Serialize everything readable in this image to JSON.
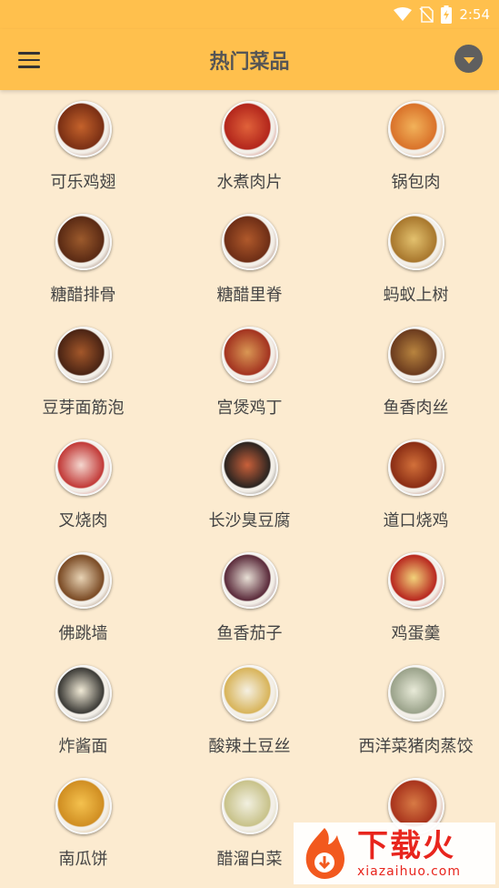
{
  "status": {
    "time": "2:54"
  },
  "appbar": {
    "title": "热门菜品"
  },
  "dishes": [
    {
      "label": "可乐鸡翅",
      "c1": "#7a2f14",
      "c2": "#c4622b"
    },
    {
      "label": "水煮肉片",
      "c1": "#b3261c",
      "c2": "#e0623a"
    },
    {
      "label": "锅包肉",
      "c1": "#d9722a",
      "c2": "#f2b25a"
    },
    {
      "label": "糖醋排骨",
      "c1": "#5a2a14",
      "c2": "#9c5a2c"
    },
    {
      "label": "糖醋里脊",
      "c1": "#6e2e16",
      "c2": "#b0592b"
    },
    {
      "label": "蚂蚁上树",
      "c1": "#a8772d",
      "c2": "#e3c16e"
    },
    {
      "label": "豆芽面筋泡",
      "c1": "#4a2414",
      "c2": "#a3572a"
    },
    {
      "label": "宫煲鸡丁",
      "c1": "#a33320",
      "c2": "#d99754"
    },
    {
      "label": "鱼香肉丝",
      "c1": "#6b3b1e",
      "c2": "#b8843f"
    },
    {
      "label": "叉烧肉",
      "c1": "#c23a38",
      "c2": "#f4d7cf"
    },
    {
      "label": "长沙臭豆腐",
      "c1": "#2b2420",
      "c2": "#c9603a"
    },
    {
      "label": "道口烧鸡",
      "c1": "#8a2d14",
      "c2": "#d2703a"
    },
    {
      "label": "佛跳墙",
      "c1": "#7a4a24",
      "c2": "#e8d3b4"
    },
    {
      "label": "鱼香茄子",
      "c1": "#5a2a3a",
      "c2": "#e8e0d6"
    },
    {
      "label": "鸡蛋羹",
      "c1": "#b8281f",
      "c2": "#f2d27a"
    },
    {
      "label": "炸酱面",
      "c1": "#3b3a36",
      "c2": "#f1ead6"
    },
    {
      "label": "酸辣土豆丝",
      "c1": "#d8b45a",
      "c2": "#f5f0e2"
    },
    {
      "label": "西洋菜猪肉蒸饺",
      "c1": "#9aa28a",
      "c2": "#e8ead8"
    },
    {
      "label": "南瓜饼",
      "c1": "#d08e22",
      "c2": "#f4c14e"
    },
    {
      "label": "醋溜白菜",
      "c1": "#c8c28a",
      "c2": "#f2f0e0"
    },
    {
      "label": "",
      "c1": "#a8331c",
      "c2": "#d77a45"
    }
  ],
  "watermark": {
    "big": "下载火",
    "small": "xiazaihuo.com"
  }
}
